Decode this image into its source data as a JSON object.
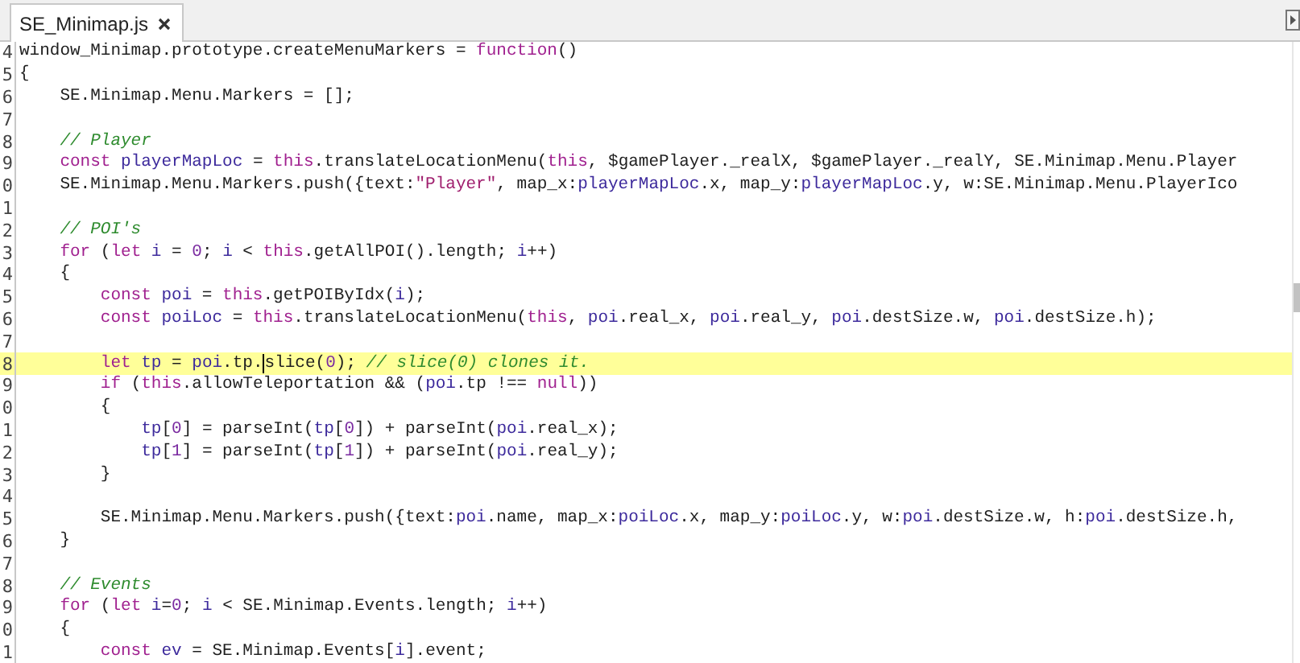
{
  "tabs": [
    {
      "label": "SE_Minimap.js",
      "selected": true
    }
  ],
  "editor": {
    "lines": [
      {
        "number": "4",
        "highlighted": false,
        "segments": [
          {
            "kind": "plain",
            "text": "window_Minimap.prototype.createMenuMarkers = "
          },
          {
            "kind": "keyword",
            "text": "function"
          },
          {
            "kind": "plain",
            "text": "()"
          }
        ]
      },
      {
        "number": "5",
        "highlighted": false,
        "segments": [
          {
            "kind": "plain",
            "text": "{"
          }
        ]
      },
      {
        "number": "6",
        "highlighted": false,
        "segments": [
          {
            "kind": "plain",
            "text": "    SE.Minimap.Menu.Markers = [];"
          }
        ]
      },
      {
        "number": "7",
        "highlighted": false
      },
      {
        "number": "8",
        "highlighted": false,
        "segments": [
          {
            "kind": "comment",
            "text": "    // Player"
          }
        ]
      },
      {
        "number": "9",
        "highlighted": false,
        "segments": [
          {
            "kind": "keyword",
            "text": "    const "
          },
          {
            "kind": "ident",
            "text": "playerMapLoc"
          },
          {
            "kind": "plain",
            "text": " = "
          },
          {
            "kind": "keyword",
            "text": "this"
          },
          {
            "kind": "plain",
            "text": ".translateLocationMenu("
          },
          {
            "kind": "keyword",
            "text": "this"
          },
          {
            "kind": "plain",
            "text": ", $gamePlayer._realX, $gamePlayer._realY, SE.Minimap.Menu.Player"
          }
        ]
      },
      {
        "number": "0",
        "highlighted": false,
        "segments": [
          {
            "kind": "plain",
            "text": "    SE.Minimap.Menu.Markers.push({text:"
          },
          {
            "kind": "string",
            "text": "\"Player\""
          },
          {
            "kind": "plain",
            "text": ", map_x:"
          },
          {
            "kind": "ident",
            "text": "playerMapLoc"
          },
          {
            "kind": "plain",
            "text": ".x, map_y:"
          },
          {
            "kind": "ident",
            "text": "playerMapLoc"
          },
          {
            "kind": "plain",
            "text": ".y, w:SE.Minimap.Menu.PlayerIco"
          }
        ]
      },
      {
        "number": "1",
        "highlighted": false
      },
      {
        "number": "2",
        "highlighted": false,
        "segments": [
          {
            "kind": "comment",
            "text": "    // POI's"
          }
        ]
      },
      {
        "number": "3",
        "highlighted": false,
        "segments": [
          {
            "kind": "keyword",
            "text": "    for"
          },
          {
            "kind": "plain",
            "text": " ("
          },
          {
            "kind": "keyword",
            "text": "let"
          },
          {
            "kind": "ident",
            "text": " i"
          },
          {
            "kind": "plain",
            "text": " = "
          },
          {
            "kind": "number",
            "text": "0"
          },
          {
            "kind": "plain",
            "text": "; "
          },
          {
            "kind": "ident",
            "text": "i"
          },
          {
            "kind": "plain",
            "text": " < "
          },
          {
            "kind": "keyword",
            "text": "this"
          },
          {
            "kind": "plain",
            "text": ".getAllPOI().length; "
          },
          {
            "kind": "ident",
            "text": "i"
          },
          {
            "kind": "plain",
            "text": "++)"
          }
        ]
      },
      {
        "number": "4",
        "highlighted": false,
        "segments": [
          {
            "kind": "plain",
            "text": "    {"
          }
        ]
      },
      {
        "number": "5",
        "highlighted": false,
        "segments": [
          {
            "kind": "keyword",
            "text": "        const "
          },
          {
            "kind": "ident",
            "text": "poi"
          },
          {
            "kind": "plain",
            "text": " = "
          },
          {
            "kind": "keyword",
            "text": "this"
          },
          {
            "kind": "plain",
            "text": ".getPOIByIdx("
          },
          {
            "kind": "ident",
            "text": "i"
          },
          {
            "kind": "plain",
            "text": ");"
          }
        ]
      },
      {
        "number": "6",
        "highlighted": false,
        "segments": [
          {
            "kind": "keyword",
            "text": "        const "
          },
          {
            "kind": "ident",
            "text": "poiLoc"
          },
          {
            "kind": "plain",
            "text": " = "
          },
          {
            "kind": "keyword",
            "text": "this"
          },
          {
            "kind": "plain",
            "text": ".translateLocationMenu("
          },
          {
            "kind": "keyword",
            "text": "this"
          },
          {
            "kind": "plain",
            "text": ", "
          },
          {
            "kind": "ident",
            "text": "poi"
          },
          {
            "kind": "plain",
            "text": ".real_x, "
          },
          {
            "kind": "ident",
            "text": "poi"
          },
          {
            "kind": "plain",
            "text": ".real_y, "
          },
          {
            "kind": "ident",
            "text": "poi"
          },
          {
            "kind": "plain",
            "text": ".destSize.w, "
          },
          {
            "kind": "ident",
            "text": "poi"
          },
          {
            "kind": "plain",
            "text": ".destSize.h);"
          }
        ]
      },
      {
        "number": "7",
        "highlighted": false
      },
      {
        "number": "8",
        "highlighted": true,
        "segments": [
          {
            "kind": "keyword",
            "text": "        let "
          },
          {
            "kind": "ident",
            "text": "tp"
          },
          {
            "kind": "plain",
            "text": " = "
          },
          {
            "kind": "ident",
            "text": "poi"
          },
          {
            "kind": "plain",
            "text": ".tp."
          },
          {
            "kind": "plain",
            "text": "slice(",
            "caret": true
          },
          {
            "kind": "number",
            "text": "0"
          },
          {
            "kind": "plain",
            "text": "); "
          },
          {
            "kind": "comment",
            "text": "// slice(0) clones it."
          }
        ]
      },
      {
        "number": "9",
        "highlighted": false,
        "segments": [
          {
            "kind": "keyword",
            "text": "        if"
          },
          {
            "kind": "plain",
            "text": " ("
          },
          {
            "kind": "keyword",
            "text": "this"
          },
          {
            "kind": "plain",
            "text": ".allowTeleportation && ("
          },
          {
            "kind": "ident",
            "text": "poi"
          },
          {
            "kind": "plain",
            "text": ".tp !== "
          },
          {
            "kind": "keyword",
            "text": "null"
          },
          {
            "kind": "plain",
            "text": "))"
          }
        ]
      },
      {
        "number": "0",
        "highlighted": false,
        "segments": [
          {
            "kind": "plain",
            "text": "        {"
          }
        ]
      },
      {
        "number": "1",
        "highlighted": false,
        "segments": [
          {
            "kind": "ident",
            "text": "            tp"
          },
          {
            "kind": "plain",
            "text": "["
          },
          {
            "kind": "number",
            "text": "0"
          },
          {
            "kind": "plain",
            "text": "] = parseInt("
          },
          {
            "kind": "ident",
            "text": "tp"
          },
          {
            "kind": "plain",
            "text": "["
          },
          {
            "kind": "number",
            "text": "0"
          },
          {
            "kind": "plain",
            "text": "]) + parseInt("
          },
          {
            "kind": "ident",
            "text": "poi"
          },
          {
            "kind": "plain",
            "text": ".real_x);"
          }
        ]
      },
      {
        "number": "2",
        "highlighted": false,
        "segments": [
          {
            "kind": "ident",
            "text": "            tp"
          },
          {
            "kind": "plain",
            "text": "["
          },
          {
            "kind": "number",
            "text": "1"
          },
          {
            "kind": "plain",
            "text": "] = parseInt("
          },
          {
            "kind": "ident",
            "text": "tp"
          },
          {
            "kind": "plain",
            "text": "["
          },
          {
            "kind": "number",
            "text": "1"
          },
          {
            "kind": "plain",
            "text": "]) + parseInt("
          },
          {
            "kind": "ident",
            "text": "poi"
          },
          {
            "kind": "plain",
            "text": ".real_y);"
          }
        ]
      },
      {
        "number": "3",
        "highlighted": false,
        "segments": [
          {
            "kind": "plain",
            "text": "        }"
          }
        ]
      },
      {
        "number": "4",
        "highlighted": false
      },
      {
        "number": "5",
        "highlighted": false,
        "segments": [
          {
            "kind": "plain",
            "text": "        SE.Minimap.Menu.Markers.push({text:"
          },
          {
            "kind": "ident",
            "text": "poi"
          },
          {
            "kind": "plain",
            "text": ".name, map_x:"
          },
          {
            "kind": "ident",
            "text": "poiLoc"
          },
          {
            "kind": "plain",
            "text": ".x, map_y:"
          },
          {
            "kind": "ident",
            "text": "poiLoc"
          },
          {
            "kind": "plain",
            "text": ".y, w:"
          },
          {
            "kind": "ident",
            "text": "poi"
          },
          {
            "kind": "plain",
            "text": ".destSize.w, h:"
          },
          {
            "kind": "ident",
            "text": "poi"
          },
          {
            "kind": "plain",
            "text": ".destSize.h,"
          }
        ]
      },
      {
        "number": "6",
        "highlighted": false,
        "segments": [
          {
            "kind": "plain",
            "text": "    }"
          }
        ]
      },
      {
        "number": "7",
        "highlighted": false
      },
      {
        "number": "8",
        "highlighted": false,
        "segments": [
          {
            "kind": "comment",
            "text": "    // Events"
          }
        ]
      },
      {
        "number": "9",
        "highlighted": false,
        "segments": [
          {
            "kind": "keyword",
            "text": "    for"
          },
          {
            "kind": "plain",
            "text": " ("
          },
          {
            "kind": "keyword",
            "text": "let"
          },
          {
            "kind": "ident",
            "text": " i"
          },
          {
            "kind": "plain",
            "text": "="
          },
          {
            "kind": "number",
            "text": "0"
          },
          {
            "kind": "plain",
            "text": "; "
          },
          {
            "kind": "ident",
            "text": "i"
          },
          {
            "kind": "plain",
            "text": " < SE.Minimap.Events.length; "
          },
          {
            "kind": "ident",
            "text": "i"
          },
          {
            "kind": "plain",
            "text": "++)"
          }
        ]
      },
      {
        "number": "0",
        "highlighted": false,
        "segments": [
          {
            "kind": "plain",
            "text": "    {"
          }
        ]
      },
      {
        "number": "1",
        "highlighted": false,
        "segments": [
          {
            "kind": "keyword",
            "text": "        const "
          },
          {
            "kind": "ident",
            "text": "ev"
          },
          {
            "kind": "plain",
            "text": " = SE.Minimap.Events["
          },
          {
            "kind": "ident",
            "text": "i"
          },
          {
            "kind": "plain",
            "text": "].event;"
          }
        ]
      }
    ]
  }
}
